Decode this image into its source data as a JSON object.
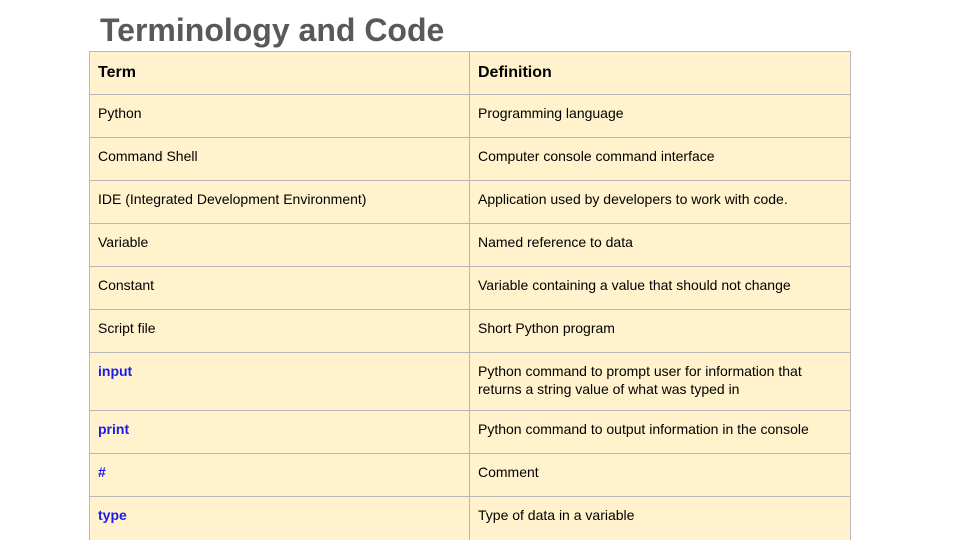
{
  "slide": {
    "title": "Terminology and Code"
  },
  "table": {
    "headers": [
      "Term",
      "Definition"
    ],
    "rows": [
      {
        "term": "Python",
        "definition": "Programming language",
        "is_code": false
      },
      {
        "term": "Command Shell",
        "definition": "Computer console command interface",
        "is_code": false
      },
      {
        "term": "IDE (Integrated Development Environment)",
        "definition": "Application used by developers to work with code.",
        "is_code": false
      },
      {
        "term": "Variable",
        "definition": "Named reference to data",
        "is_code": false
      },
      {
        "term": "Constant",
        "definition": "Variable containing a value that should not change",
        "is_code": false
      },
      {
        "term": "Script file",
        "definition": "Short Python program",
        "is_code": false
      },
      {
        "term": "input",
        "definition": "Python command to prompt user for information that returns a string value of what was typed in",
        "is_code": true
      },
      {
        "term": "print",
        "definition": "Python command to output information in the console",
        "is_code": true
      },
      {
        "term": "#",
        "definition": "Comment",
        "is_code": true
      },
      {
        "term": "type",
        "definition": "Type of data in a variable",
        "is_code": true
      }
    ]
  },
  "colors": {
    "title": "#595959",
    "table_background": "#fff2cc",
    "table_border": "#b7b7b7",
    "code_term": "#1a1af0"
  }
}
